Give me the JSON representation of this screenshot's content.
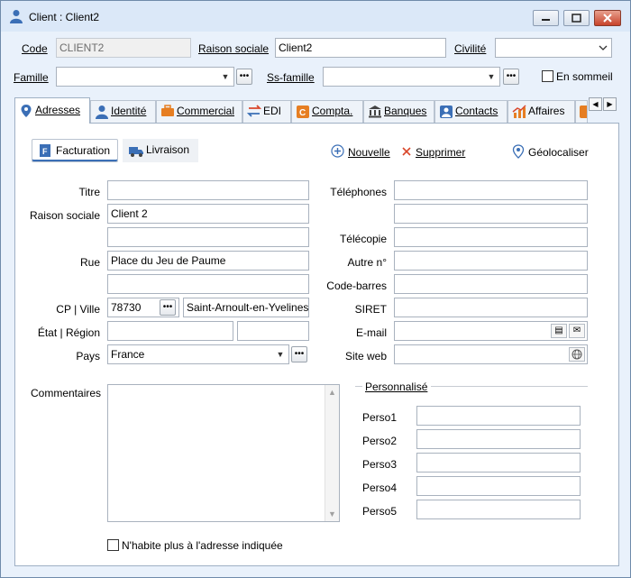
{
  "window": {
    "title": "Client : Client2"
  },
  "header": {
    "code_label": "Code",
    "code_value": "CLIENT2",
    "raison_label": "Raison sociale",
    "raison_value": "Client2",
    "civilite_label": "Civilité",
    "civilite_value": "",
    "famille_label": "Famille",
    "famille_value": "",
    "ssfamille_label": "Ss-famille",
    "ssfamille_value": "",
    "sommeil_label": "En sommeil"
  },
  "tabs": [
    {
      "label": "Adresses",
      "icon": "map-pin-icon"
    },
    {
      "label": "Identité",
      "icon": "person-icon"
    },
    {
      "label": "Commercial",
      "icon": "briefcase-icon"
    },
    {
      "label": "EDI",
      "icon": "arrows-exchange-icon"
    },
    {
      "label": "Compta.",
      "icon": "accounting-icon"
    },
    {
      "label": "Banques",
      "icon": "bank-icon"
    },
    {
      "label": "Contacts",
      "icon": "contacts-icon"
    },
    {
      "label": "Affaires",
      "icon": "chart-icon"
    }
  ],
  "subtabs": {
    "facturation": "Facturation",
    "livraison": "Livraison"
  },
  "actions": {
    "nouvelle": "Nouvelle",
    "supprimer": "Supprimer",
    "geolocaliser": "Géolocaliser"
  },
  "form": {
    "titre_label": "Titre",
    "titre_value": "",
    "raison_label": "Raison sociale",
    "raison_value": "Client 2",
    "raison2_value": "",
    "rue_label": "Rue",
    "rue_value": "Place du Jeu de Paume",
    "rue2_value": "",
    "cpville_label": "CP | Ville",
    "cp_value": "78730",
    "ville_value": "Saint-Arnoult-en-Yvelines",
    "etat_label": "État | Région",
    "etat_value": "",
    "region_value": "",
    "pays_label": "Pays",
    "pays_value": "France",
    "telephones_label": "Téléphones",
    "tel1_value": "",
    "tel2_value": "",
    "telecopie_label": "Télécopie",
    "telecopie_value": "",
    "autre_label": "Autre n°",
    "autre_value": "",
    "codebarres_label": "Code-barres",
    "codebarres_value": "",
    "siret_label": "SIRET",
    "siret_value": "",
    "email_label": "E-mail",
    "email_value": "",
    "siteweb_label": "Site web",
    "siteweb_value": "",
    "commentaires_label": "Commentaires",
    "commentaires_value": "",
    "personnalise_label": "Personnalisé",
    "perso": [
      {
        "label": "Perso1",
        "value": ""
      },
      {
        "label": "Perso2",
        "value": ""
      },
      {
        "label": "Perso3",
        "value": ""
      },
      {
        "label": "Perso4",
        "value": ""
      },
      {
        "label": "Perso5",
        "value": ""
      }
    ],
    "nhabite_label": "N'habite plus à l'adresse indiquée"
  },
  "colors": {
    "window_bg": "#e9f1fb",
    "accent_blue": "#3b6fb6",
    "close_red": "#c8432b",
    "orange": "#e67e22"
  }
}
